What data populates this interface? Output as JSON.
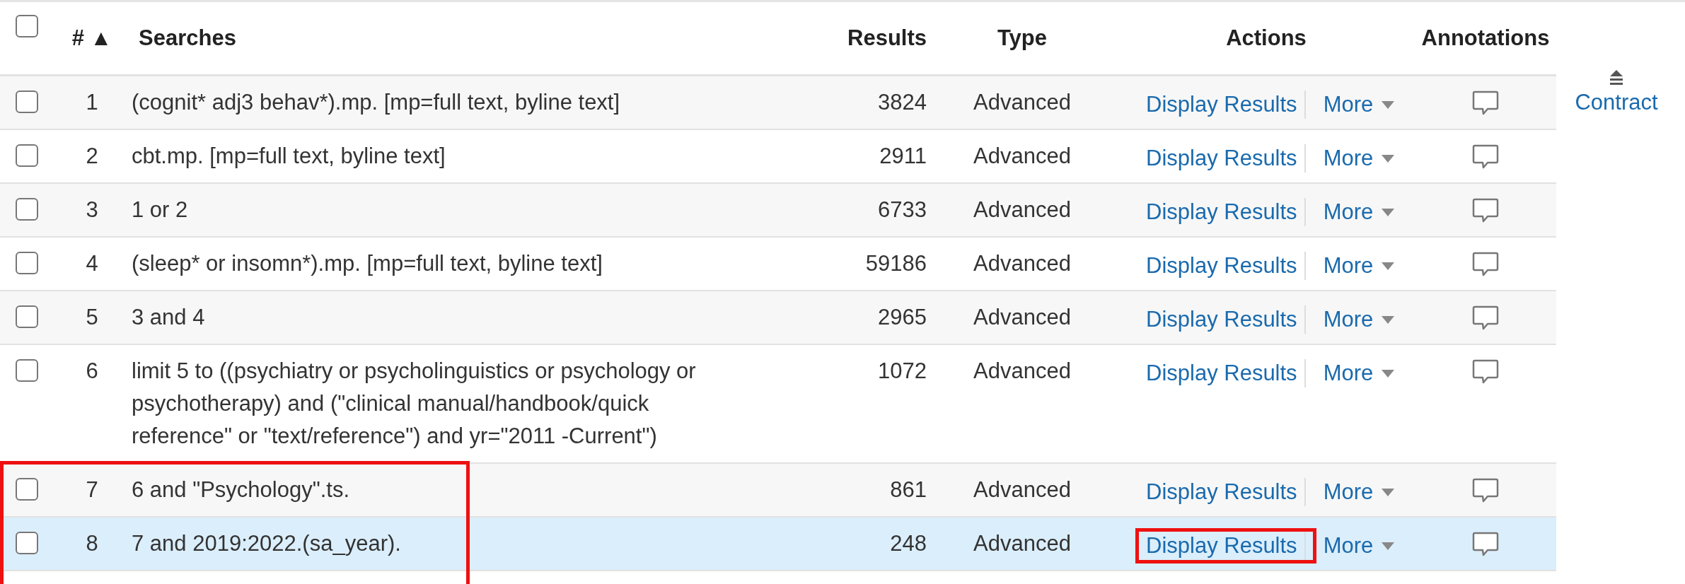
{
  "header": {
    "select_all": {
      "checked": false
    },
    "columns": [
      {
        "kind": "number",
        "label": "#",
        "sort": "▲"
      },
      {
        "kind": "search",
        "label": "Searches"
      },
      {
        "kind": "results",
        "label": "Results"
      },
      {
        "kind": "type",
        "label": "Type"
      },
      {
        "kind": "actions",
        "label": "Actions"
      },
      {
        "kind": "annotations",
        "label": "Annotations"
      }
    ]
  },
  "rows": [
    {
      "number": "1",
      "search": "(cognit* adj3 behav*).mp. [mp=full text, byline text]",
      "results": "3824",
      "type": "Advanced",
      "actions": [
        "Display Results",
        "More"
      ],
      "checked": false,
      "selected": false,
      "framed": false,
      "action_framed": false
    },
    {
      "number": "2",
      "search": "cbt.mp. [mp=full text, byline text]",
      "results": "2911",
      "type": "Advanced",
      "actions": [
        "Display Results",
        "More"
      ],
      "checked": false,
      "selected": false,
      "framed": false,
      "action_framed": false
    },
    {
      "number": "3",
      "search": "1 or 2",
      "results": "6733",
      "type": "Advanced",
      "actions": [
        "Display Results",
        "More"
      ],
      "checked": false,
      "selected": false,
      "framed": false,
      "action_framed": false
    },
    {
      "number": "4",
      "search": "(sleep* or insomn*).mp. [mp=full text, byline text]",
      "results": "59186",
      "type": "Advanced",
      "actions": [
        "Display Results",
        "More"
      ],
      "checked": false,
      "selected": false,
      "framed": false,
      "action_framed": false
    },
    {
      "number": "5",
      "search": "3 and 4",
      "results": "2965",
      "type": "Advanced",
      "actions": [
        "Display Results",
        "More"
      ],
      "checked": false,
      "selected": false,
      "framed": false,
      "action_framed": false
    },
    {
      "number": "6",
      "search": "limit 5 to ((psychiatry or psycholinguistics or psychology or psychotherapy) and (\"clinical manual/handbook/quick reference\" or \"text/reference\") and yr=\"2011 -Current\")",
      "results": "1072",
      "type": "Advanced",
      "actions": [
        "Display Results",
        "More"
      ],
      "checked": false,
      "selected": false,
      "framed": false,
      "action_framed": false
    },
    {
      "number": "7",
      "search": "6 and \"Psychology\".ts.",
      "results": "861",
      "type": "Advanced",
      "actions": [
        "Display Results",
        "More"
      ],
      "checked": false,
      "selected": false,
      "framed": true,
      "action_framed": false
    },
    {
      "number": "8",
      "search": "7 and 2019:2022.(sa_year).",
      "results": "248",
      "type": "Advanced",
      "actions": [
        "Display Results",
        "More"
      ],
      "checked": false,
      "selected": true,
      "framed": true,
      "action_framed": true
    }
  ],
  "side": {
    "contract": "Contract"
  }
}
